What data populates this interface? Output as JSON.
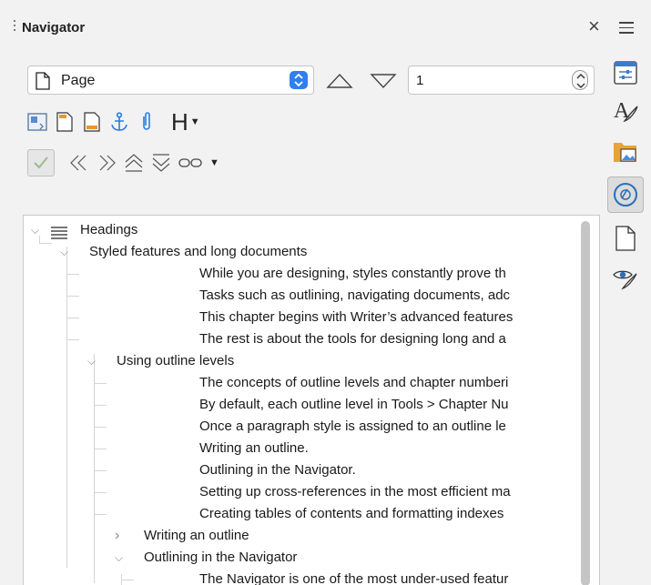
{
  "title": "Navigator",
  "selector": {
    "value": "Page"
  },
  "page_number": "1",
  "tree": {
    "root": "Headings",
    "rows": [
      {
        "text": "Styled features and long documents",
        "level": 1,
        "expander": "down"
      },
      {
        "text": "While you are designing, styles constantly prove th",
        "level": 3
      },
      {
        "text": "Tasks such as outlining, navigating documents, adc",
        "level": 3
      },
      {
        "text": "This chapter begins with Writer’s advanced features",
        "level": 3
      },
      {
        "text": "The rest is about the tools for designing long and a",
        "level": 3
      },
      {
        "text": "Using outline levels",
        "level": 2,
        "expander": "down"
      },
      {
        "text": "The concepts of outline levels and chapter numberi",
        "level": 3
      },
      {
        "text": "By default, each outline level in Tools > Chapter Nu",
        "level": 3
      },
      {
        "text": "Once a paragraph style is assigned to an outline le",
        "level": 3
      },
      {
        "text": "Writing an outline.",
        "level": 3
      },
      {
        "text": "Outlining in the Navigator.",
        "level": 3
      },
      {
        "text": "Setting up cross-references in the most efficient ma",
        "level": 3
      },
      {
        "text": "Creating tables of contents and formatting indexes",
        "level": 3
      },
      {
        "text": "Writing an outline",
        "level": 2.5,
        "expander": "right"
      },
      {
        "text": "Outlining in the Navigator",
        "level": 2.5,
        "expander": "down"
      },
      {
        "text": "The Navigator is one of the most under-used featur",
        "level": 3
      }
    ]
  },
  "icons": {
    "toolbar1": [
      "toggle-master-icon",
      "header-icon",
      "footer-icon",
      "anchor-icon",
      "endnote-icon",
      "heading-style-icon"
    ],
    "toolbar2": [
      "content-view-icon",
      "promote-chapter-icon",
      "demote-chapter-icon",
      "promote-level-icon",
      "demote-level-icon",
      "drag-mode-icon"
    ],
    "sidebar": [
      "properties-icon",
      "styles-icon",
      "gallery-icon",
      "navigator-icon",
      "page-icon",
      "style-inspector-icon"
    ]
  },
  "colors": {
    "accent": "#2f80ed",
    "anchor": "#2a7de1",
    "gallery_folder": "#e9a23b"
  }
}
